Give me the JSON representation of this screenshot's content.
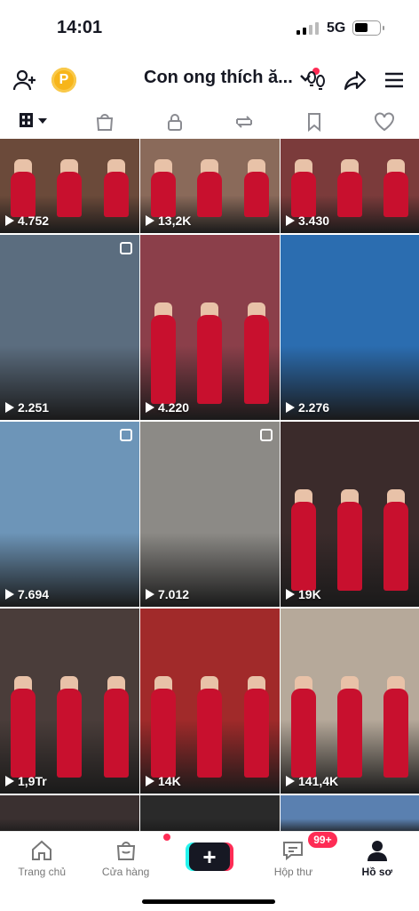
{
  "status_bar": {
    "time": "14:01",
    "network": "5G"
  },
  "header": {
    "profile_name": "Con ong thích ă...",
    "coin_label": "P"
  },
  "tabs": [
    {
      "name": "grid",
      "icon": "grid-icon"
    },
    {
      "name": "shop",
      "icon": "shopping-bag-icon"
    },
    {
      "name": "private",
      "icon": "lock-icon"
    },
    {
      "name": "reposts",
      "icon": "repost-icon"
    },
    {
      "name": "favorites",
      "icon": "bookmark-icon"
    },
    {
      "name": "liked",
      "icon": "heart-icon"
    }
  ],
  "videos": [
    {
      "views": "4.752",
      "bg": "#6b4a3a"
    },
    {
      "views": "13,2K",
      "bg": "#8a6a5a"
    },
    {
      "views": "3.430",
      "bg": "#7b3b3b"
    },
    {
      "views": "2.251",
      "bg": "#5b6d7f"
    },
    {
      "views": "4.220",
      "bg": "#8b3f4a"
    },
    {
      "views": "2.276",
      "bg": "#2b6db0"
    },
    {
      "views": "7.694",
      "bg": "#6d95b8"
    },
    {
      "views": "7.012",
      "bg": "#8c8a86"
    },
    {
      "views": "19K",
      "bg": "#3b2b2b"
    },
    {
      "views": "1,9Tr",
      "bg": "#4a3d3a"
    },
    {
      "views": "14K",
      "bg": "#a12a2a"
    },
    {
      "views": "141,4K",
      "bg": "#b6a99a"
    },
    {
      "views": "",
      "bg": "#3a3030"
    },
    {
      "views": "",
      "bg": "#2a2a2a"
    },
    {
      "views": "",
      "bg": "#5a80b0"
    }
  ],
  "bottom_nav": {
    "home": "Trang chủ",
    "shop": "Cửa hàng",
    "create": "+",
    "inbox": "Hộp thư",
    "inbox_badge": "99+",
    "profile": "Hồ sơ"
  },
  "colors": {
    "accent": "#fe2c55",
    "cyan": "#25f4ee",
    "coin": "#f7b51a"
  }
}
